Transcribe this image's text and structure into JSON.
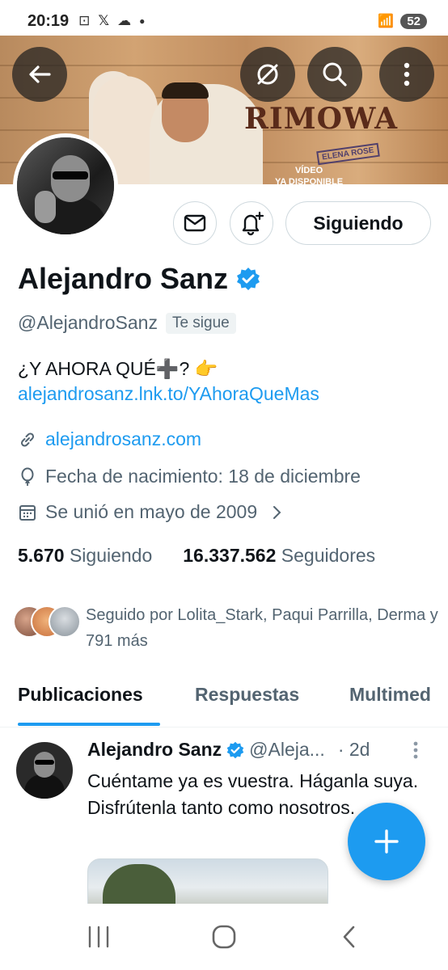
{
  "status_bar": {
    "time": "20:19",
    "icons": [
      "screenshot-icon",
      "x-logo-icon",
      "cloud-icon",
      "dot-icon"
    ],
    "battery": "52"
  },
  "banner": {
    "brand": "RIMOWA",
    "stamp": "ELENA ROSE",
    "subtitle_line1": "VÍDEO",
    "subtitle_line2": "YA DISPONIBLE"
  },
  "profile_actions": {
    "follow_label": "Siguiendo"
  },
  "profile": {
    "name": "Alejandro Sanz",
    "handle": "@AlejandroSanz",
    "follows_you": "Te sigue",
    "bio": "¿Y AHORA QUÉ➕? 👉",
    "bio_link": "alejandrosanz.lnk.to/YAhoraQueMas",
    "website": "alejandrosanz.com",
    "birthday": "Fecha de nacimiento: 18 de diciembre",
    "joined": "Se unió en mayo de 2009"
  },
  "stats": {
    "following_count": "5.670",
    "following_label": "Siguiendo",
    "followers_count": "16.337.562",
    "followers_label": "Seguidores"
  },
  "followed_by": {
    "text": "Seguido por Lolita_Stark, Paqui Parrilla, Derma y 791 más"
  },
  "tabs": [
    {
      "label": "Publicaciones",
      "active": true
    },
    {
      "label": "Respuestas",
      "active": false
    },
    {
      "label": "Multimed",
      "active": false
    }
  ],
  "post": {
    "name": "Alejandro Sanz",
    "handle": "@Aleja...",
    "time": "· 2d",
    "text": "Cuéntame ya es vuestra. Háganla suya. Disfrútenla tanto como nosotros."
  },
  "colors": {
    "accent": "#1d9bf0",
    "text": "#0f1419",
    "secondary": "#536471",
    "verified": "#1d9bf0"
  }
}
